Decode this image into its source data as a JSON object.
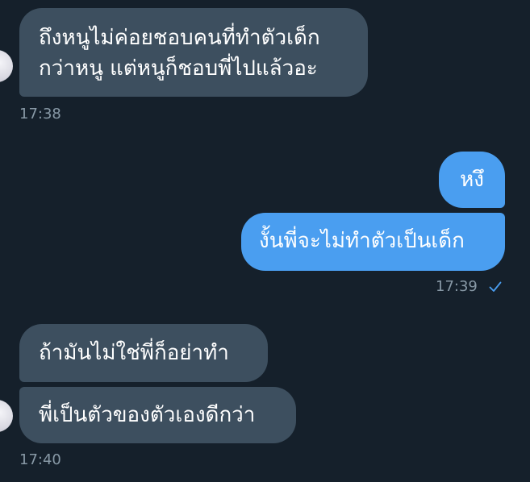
{
  "conversation": {
    "block1": {
      "message1": "ถึงหนูไม่ค่อยชอบคนที่ทำตัวเด็ก\nกว่าหนู แต่หนูก็ชอบพี่ไปแล้วอะ",
      "time": "17:38"
    },
    "block2": {
      "message1": "หงึ",
      "message2": "งั้นพี่จะไม่ทำตัวเป็นเด็ก",
      "time": "17:39",
      "read_status_icon": "single-check-icon"
    },
    "block3": {
      "message1": "ถ้ามันไม่ใช่พี่ก็อย่าทำ",
      "message2": "พี่เป็นตัวของตัวเองดีกว่า",
      "time": "17:40"
    }
  },
  "colors": {
    "background": "#15202b",
    "incoming_bubble": "#3d4f5f",
    "outgoing_bubble": "#4a9ef0",
    "timestamp": "#8899a6",
    "check": "#4a9ef0"
  }
}
